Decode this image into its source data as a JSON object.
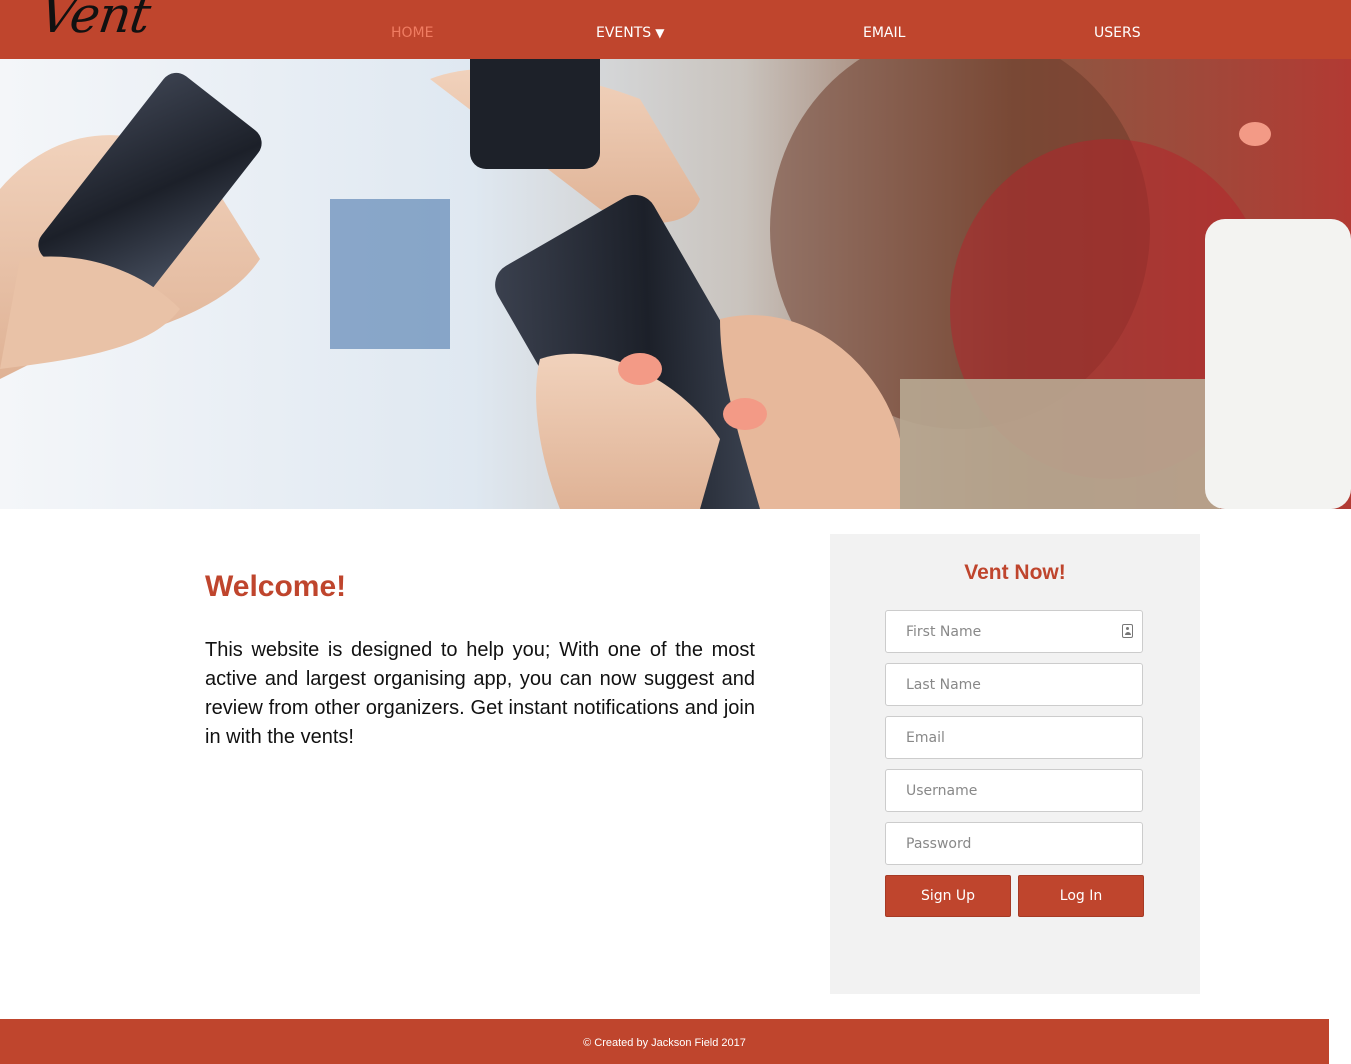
{
  "brand": {
    "logo_text": "Vent"
  },
  "nav": {
    "home": "HOME",
    "events": "EVENTS",
    "events_caret": "▼",
    "email": "EMAIL",
    "users": "USERS"
  },
  "hero": {
    "image_description": "hands holding smartphones"
  },
  "welcome": {
    "title": "Welcome!",
    "body": "This website is designed to help you; With one of the most active and largest organising app, you can now suggest and review from other organizers. Get instant notifications and join in with the vents!"
  },
  "signup_form": {
    "title": "Vent Now!",
    "first_name_placeholder": "First Name",
    "last_name_placeholder": "Last Name",
    "email_placeholder": "Email",
    "username_placeholder": "Username",
    "password_placeholder": "Password",
    "signup_label": "Sign Up",
    "login_label": "Log In"
  },
  "footer": {
    "text": "© Created by Jackson Field 2017"
  },
  "colors": {
    "brand": "#bf452d",
    "nav_active": "#f07c62",
    "panel_bg": "#f2f2f2"
  }
}
